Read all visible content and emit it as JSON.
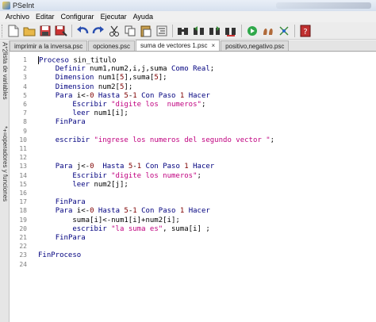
{
  "window": {
    "title": "PSeInt"
  },
  "menu": [
    "Archivo",
    "Editar",
    "Configurar",
    "Ejecutar",
    "Ayuda"
  ],
  "toolbar": {
    "buttons": [
      "new-file-icon",
      "open-folder-icon",
      "save-icon",
      "save-as-icon",
      "undo-icon",
      "redo-icon",
      "cut-icon",
      "copy-icon",
      "paste-icon",
      "indent-icon",
      "find-icon",
      "find-previous-icon",
      "find-next-icon",
      "replace-icon",
      "run-icon",
      "step-icon",
      "flowchart-icon",
      "help-icon"
    ]
  },
  "sidebar": {
    "var_panel_label": "lista de variables",
    "var_panel_icons": "*+=",
    "ops_panel_label": "operadores y funciones",
    "ops_panel_icons": "A*2"
  },
  "tabs": [
    {
      "label": "imprimir a la inversa.psc",
      "active": false
    },
    {
      "label": "opciones.psc",
      "active": false
    },
    {
      "label": "suma de vectores 1.psc",
      "active": true,
      "close": "×"
    },
    {
      "label": "positivo,negativo.psc",
      "active": false
    }
  ],
  "editor": {
    "lines": [
      {
        "n": "1",
        "tokens": [
          [
            "kw",
            "Proceso"
          ],
          [
            "id",
            " sin_titulo"
          ]
        ]
      },
      {
        "n": "2",
        "tokens": [
          [
            "id",
            "    "
          ],
          [
            "kw",
            "Definir"
          ],
          [
            "id",
            " num1,num2,i,j,suma "
          ],
          [
            "kw",
            "Como Real"
          ],
          [
            "op",
            ";"
          ]
        ]
      },
      {
        "n": "3",
        "tokens": [
          [
            "id",
            "    "
          ],
          [
            "kw",
            "Dimension"
          ],
          [
            "id",
            " num1["
          ],
          [
            "num",
            "5"
          ],
          [
            "id",
            "],suma["
          ],
          [
            "num",
            "5"
          ],
          [
            "id",
            "];"
          ]
        ]
      },
      {
        "n": "4",
        "tokens": [
          [
            "id",
            "    "
          ],
          [
            "kw",
            "Dimension"
          ],
          [
            "id",
            " num2["
          ],
          [
            "num",
            "5"
          ],
          [
            "id",
            "];"
          ]
        ]
      },
      {
        "n": "5",
        "tokens": [
          [
            "id",
            "    "
          ],
          [
            "kw",
            "Para"
          ],
          [
            "id",
            " i<-"
          ],
          [
            "num",
            "0"
          ],
          [
            "kw",
            " Hasta "
          ],
          [
            "num",
            "5"
          ],
          [
            "id",
            "-"
          ],
          [
            "num",
            "1"
          ],
          [
            "kw",
            " Con Paso "
          ],
          [
            "num",
            "1"
          ],
          [
            "kw",
            " Hacer"
          ]
        ]
      },
      {
        "n": "6",
        "tokens": [
          [
            "id",
            "        "
          ],
          [
            "kw",
            "Escribir"
          ],
          [
            "id",
            " "
          ],
          [
            "str",
            "\"digite los  numeros\""
          ],
          [
            "id",
            ";"
          ]
        ]
      },
      {
        "n": "7",
        "tokens": [
          [
            "id",
            "        "
          ],
          [
            "kw",
            "leer"
          ],
          [
            "id",
            " num1[i];"
          ]
        ]
      },
      {
        "n": "8",
        "tokens": [
          [
            "id",
            "    "
          ],
          [
            "kw",
            "FinPara"
          ]
        ]
      },
      {
        "n": "9",
        "tokens": []
      },
      {
        "n": "10",
        "tokens": [
          [
            "id",
            "    "
          ],
          [
            "kw",
            "escribir"
          ],
          [
            "id",
            " "
          ],
          [
            "str",
            "\"ingrese los numeros del segundo vector \""
          ],
          [
            "id",
            ";"
          ]
        ]
      },
      {
        "n": "11",
        "tokens": []
      },
      {
        "n": "12",
        "tokens": []
      },
      {
        "n": "13",
        "tokens": [
          [
            "id",
            "    "
          ],
          [
            "kw",
            "Para"
          ],
          [
            "id",
            " j<-"
          ],
          [
            "num",
            "0"
          ],
          [
            "kw",
            "  Hasta "
          ],
          [
            "num",
            "5"
          ],
          [
            "id",
            "-"
          ],
          [
            "num",
            "1"
          ],
          [
            "kw",
            " Con Paso "
          ],
          [
            "num",
            "1"
          ],
          [
            "kw",
            " Hacer"
          ]
        ]
      },
      {
        "n": "14",
        "tokens": [
          [
            "id",
            "        "
          ],
          [
            "kw",
            "Escribir"
          ],
          [
            "id",
            " "
          ],
          [
            "str",
            "\"digite los numeros\""
          ],
          [
            "id",
            ";"
          ]
        ]
      },
      {
        "n": "15",
        "tokens": [
          [
            "id",
            "        "
          ],
          [
            "kw",
            "leer"
          ],
          [
            "id",
            " num2[j];"
          ]
        ]
      },
      {
        "n": "16",
        "tokens": []
      },
      {
        "n": "17",
        "tokens": [
          [
            "id",
            "    "
          ],
          [
            "kw",
            "FinPara"
          ]
        ]
      },
      {
        "n": "18",
        "tokens": [
          [
            "id",
            "    "
          ],
          [
            "kw",
            "Para"
          ],
          [
            "id",
            " i<-"
          ],
          [
            "num",
            "0"
          ],
          [
            "kw",
            " Hasta "
          ],
          [
            "num",
            "5"
          ],
          [
            "id",
            "-"
          ],
          [
            "num",
            "1"
          ],
          [
            "kw",
            " Con Paso "
          ],
          [
            "num",
            "1"
          ],
          [
            "kw",
            " Hacer"
          ]
        ]
      },
      {
        "n": "19",
        "tokens": [
          [
            "id",
            "        suma[i]<-num1[i]+num2[i];"
          ]
        ]
      },
      {
        "n": "20",
        "tokens": [
          [
            "id",
            "        "
          ],
          [
            "kw",
            "escribir"
          ],
          [
            "id",
            " "
          ],
          [
            "str",
            "\"la suma es\""
          ],
          [
            "id",
            ", suma[i] ;"
          ]
        ]
      },
      {
        "n": "21",
        "tokens": [
          [
            "id",
            "    "
          ],
          [
            "kw",
            "FinPara"
          ]
        ]
      },
      {
        "n": "22",
        "tokens": []
      },
      {
        "n": "23",
        "tokens": [
          [
            "kw",
            "FinProceso"
          ]
        ]
      },
      {
        "n": "24",
        "tokens": []
      }
    ]
  },
  "colors": {
    "keyword": "#00007f",
    "number": "#7f0000",
    "string": "#c0007f",
    "gutter": "#7d7d7d"
  }
}
